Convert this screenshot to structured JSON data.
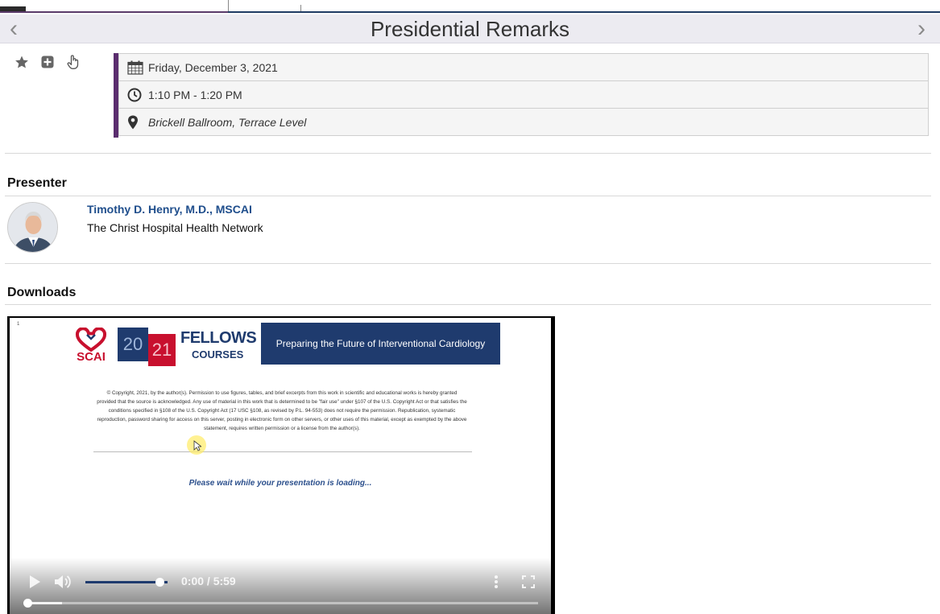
{
  "header": {
    "title": "Presidential Remarks",
    "prev_icon": "chevron-left-icon",
    "next_icon": "chevron-right-icon"
  },
  "actions": [
    {
      "icon": "star-icon"
    },
    {
      "icon": "plus-square-icon"
    },
    {
      "icon": "hand-pointer-icon"
    }
  ],
  "session": {
    "date": "Friday, December 3, 2021",
    "time": "1:10 PM - 1:20 PM",
    "location": "Brickell Ballroom, Terrace Level"
  },
  "presenter": {
    "heading": "Presenter",
    "name": "Timothy D. Henry, M.D., MSCAI",
    "organization": "The Christ Hospital Health Network"
  },
  "downloads": {
    "heading": "Downloads"
  },
  "slide": {
    "page_number": "1",
    "logo_text": "SCAI",
    "year_left": "20",
    "year_right": "21",
    "fellows": "FELLOWS",
    "courses": "COURSES",
    "banner": "Preparing the Future of Interventional Cardiology",
    "copyright": "© Copyright, 2021, by the author(s). Permission to use figures, tables, and brief excerpts from this work in scientific and educational works is hereby granted provided that the source is acknowledged. Any use of material in this work that is determined to be \"fair use\" under §107 of the U.S. Copyright Act or that satisfies the conditions specified in §108 of the U.S. Copyright Act (17 USC §108, as revised by P.L. 94-553) does not require the permission. Republication, systematic reproduction, password sharing for access on this server, posting in electronic form on other servers, or other uses of this material, except as exempted by the above statement, requires written permission or a license from the author(s).",
    "loading": "Please wait while your presentation is loading..."
  },
  "player": {
    "timecode": "0:00 / 5:59",
    "volume": 0.9,
    "progress": 0.0,
    "buffered": 0.07
  },
  "colors": {
    "accent_purple": "#5a2d6e",
    "link_blue": "#1f4e8c",
    "scai_navy": "#1f3b6e",
    "scai_red": "#c8102e"
  }
}
